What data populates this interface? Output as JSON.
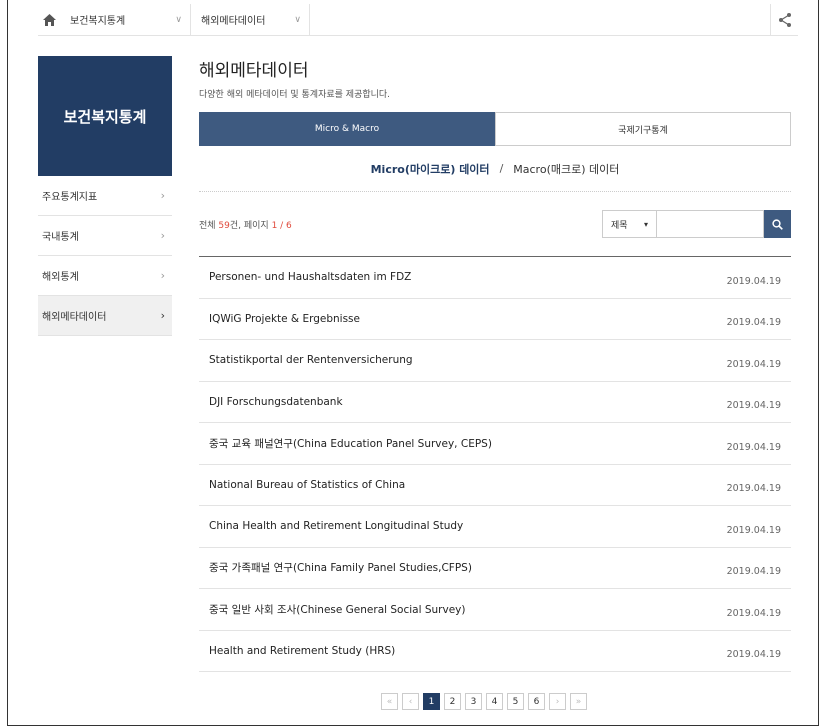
{
  "topbar": {
    "crumb1": "보건복지통계",
    "crumb2": "해외메타데이터"
  },
  "sidebar": {
    "title": "보건복지통계",
    "items": [
      {
        "label": "주요통계지표"
      },
      {
        "label": "국내통계"
      },
      {
        "label": "해외통계"
      },
      {
        "label": "해외메타데이터"
      }
    ]
  },
  "main": {
    "title": "해외메타데이터",
    "description": "다양한 해외 메타데이터 및 통계자료를 제공합니다.",
    "tabs": [
      {
        "label": "Micro & Macro"
      },
      {
        "label": "국제기구통계"
      }
    ],
    "subnav": {
      "micro": "Micro(마이크로) 데이터",
      "separator": "/",
      "macro": "Macro(매크로) 데이터"
    },
    "count": {
      "prefix": "전체 ",
      "total": "59",
      "mid": "건, 페이지 ",
      "page": "1 / 6"
    },
    "search": {
      "select_value": "제목",
      "placeholder": ""
    },
    "rows": [
      {
        "title": "Personen- und Haushaltsdaten im FDZ",
        "date": "2019.04.19"
      },
      {
        "title": "IQWiG Projekte & Ergebnisse",
        "date": "2019.04.19"
      },
      {
        "title": "Statistikportal der Rentenversicherung",
        "date": "2019.04.19"
      },
      {
        "title": "DJI Forschungsdatenbank",
        "date": "2019.04.19"
      },
      {
        "title": "중국 교육 패널연구(China Education Panel Survey, CEPS)",
        "date": "2019.04.19"
      },
      {
        "title": "National Bureau of Statistics of China",
        "date": "2019.04.19"
      },
      {
        "title": "China Health and Retirement Longitudinal Study",
        "date": "2019.04.19"
      },
      {
        "title": "중국 가족패널 연구(China Family Panel Studies,CFPS)",
        "date": "2019.04.19"
      },
      {
        "title": "중국 일반 사회 조사(Chinese General Social Survey)",
        "date": "2019.04.19"
      },
      {
        "title": "Health and Retirement Study (HRS)",
        "date": "2019.04.19"
      }
    ],
    "pagination": {
      "first": "«",
      "prev": "‹",
      "pages": [
        "1",
        "2",
        "3",
        "4",
        "5",
        "6"
      ],
      "next": "›",
      "last": "»"
    }
  },
  "colors": {
    "brand": "#223d64",
    "accent": "#3e5a80",
    "count_highlight": "#e04a3c"
  }
}
